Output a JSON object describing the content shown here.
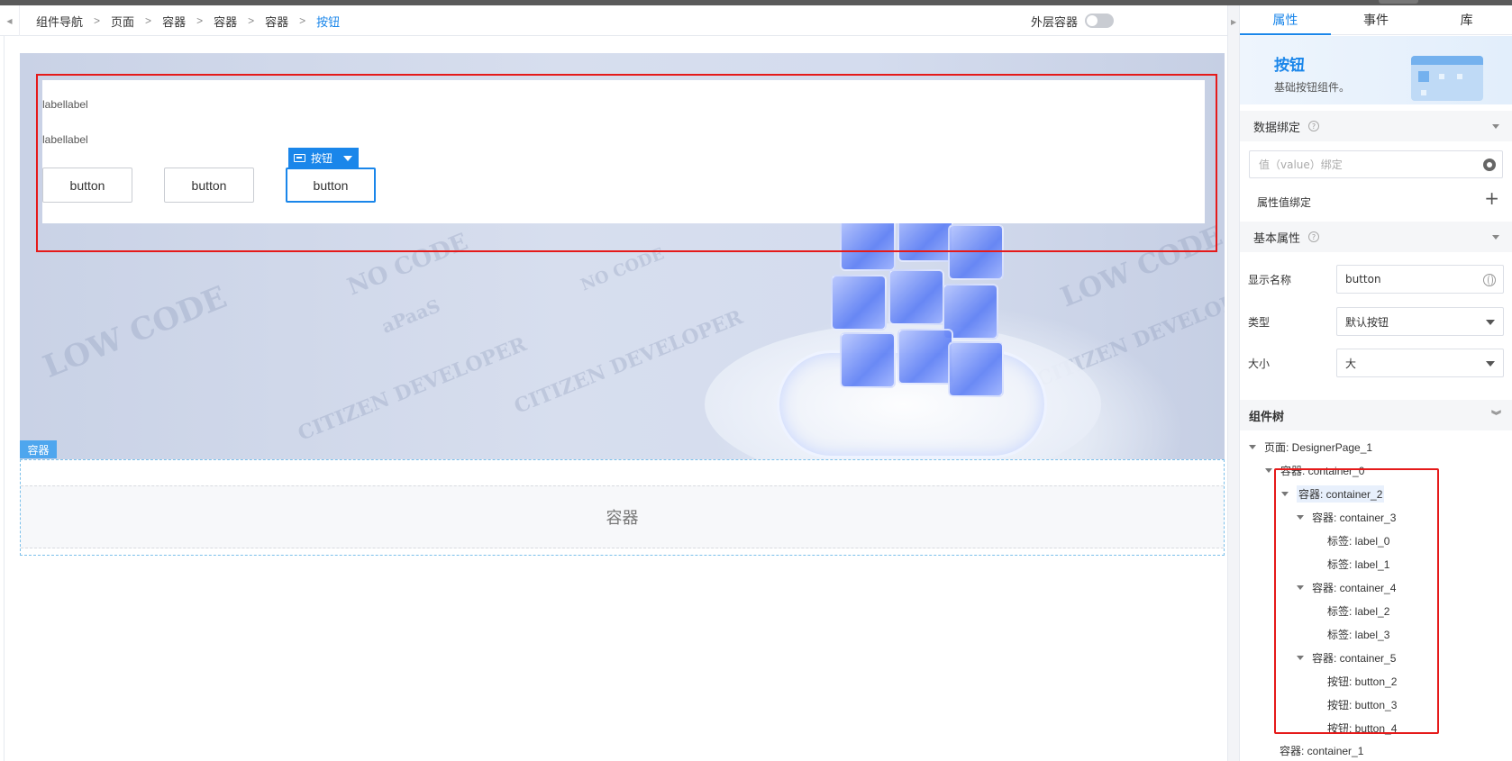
{
  "breadcrumb": {
    "items": [
      "组件导航",
      "页面",
      "容器",
      "容器",
      "容器",
      "按钮"
    ]
  },
  "toolbar": {
    "outer_container_label": "外层容器"
  },
  "canvas": {
    "labels": [
      "labellabel",
      "labellabel"
    ],
    "buttons": [
      "button",
      "button",
      "button"
    ],
    "selection_tag": "按钮",
    "container_tag": "容器",
    "container_placeholder": "容器",
    "watermarks": [
      "LOW CODE",
      "CITIZEN DEVELOPER",
      "NO CODE",
      "aPaaS",
      "CITIZEN DEVELOPER",
      "NO CODE",
      "LOW CODE",
      "CITIZEN DEVELOPER"
    ]
  },
  "panel": {
    "tabs": [
      "属性",
      "事件",
      "库"
    ],
    "active_tab": "属性",
    "component_title": "按钮",
    "component_desc": "基础按钮组件。",
    "data_binding": {
      "title": "数据绑定",
      "value_placeholder": "值（value）绑定",
      "attr_binding": "属性值绑定"
    },
    "basic_props": {
      "title": "基本属性",
      "display_name_label": "显示名称",
      "display_name_value": "button",
      "type_label": "类型",
      "type_value": "默认按钮",
      "size_label": "大小",
      "size_value": "大"
    },
    "tree": {
      "title": "组件树",
      "nodes": [
        {
          "label": "页面: DesignerPage_1",
          "expanded": true
        },
        {
          "label": "容器: container_0",
          "expanded": true
        },
        {
          "label": "容器: container_2",
          "expanded": true,
          "highlighted": true
        },
        {
          "label": "容器: container_3",
          "expanded": true
        },
        {
          "label": "标签: label_0",
          "expanded": false
        },
        {
          "label": "标签: label_1",
          "expanded": false
        },
        {
          "label": "容器: container_4",
          "expanded": true
        },
        {
          "label": "标签: label_2",
          "expanded": false
        },
        {
          "label": "标签: label_3",
          "expanded": false
        },
        {
          "label": "容器: container_5",
          "expanded": true
        },
        {
          "label": "按钮: button_2",
          "expanded": false
        },
        {
          "label": "按钮: button_3",
          "expanded": false
        },
        {
          "label": "按钮: button_4",
          "expanded": false
        },
        {
          "label": "容器: container_1",
          "expanded": false
        }
      ]
    }
  },
  "colors": {
    "accent": "#1a86ea",
    "selection_red": "#e51a1a"
  }
}
